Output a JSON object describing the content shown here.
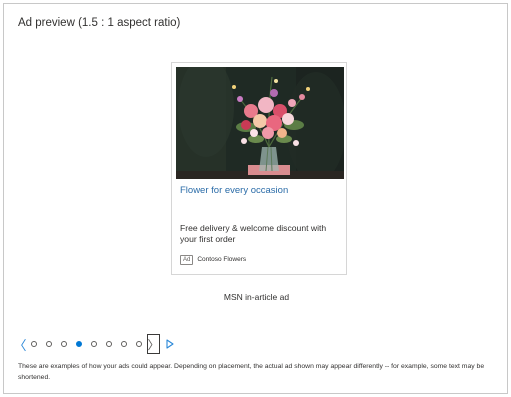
{
  "panel": {
    "title": "Ad preview (1.5 : 1 aspect ratio)"
  },
  "ad": {
    "image_icon": "flower-bouquet-image",
    "headline": "Flower for every occasion",
    "description": "Free delivery & welcome discount with your first order",
    "badge": "Ad",
    "advertiser": "Contoso Flowers"
  },
  "placement": {
    "label": "MSN in-article ad"
  },
  "pager": {
    "prev_icon": "chevron-left-icon",
    "next_icon": "chevron-right-icon",
    "play_icon": "play-icon",
    "prev_glyph": "〈",
    "next_glyph": "〉",
    "total": 8,
    "active_index": 3,
    "accent": "#0078d4"
  },
  "footer": {
    "disclaimer": "These are examples of how your ads could appear. Depending on placement, the actual ad shown may appear differently -- for example, some text may be shortened."
  }
}
